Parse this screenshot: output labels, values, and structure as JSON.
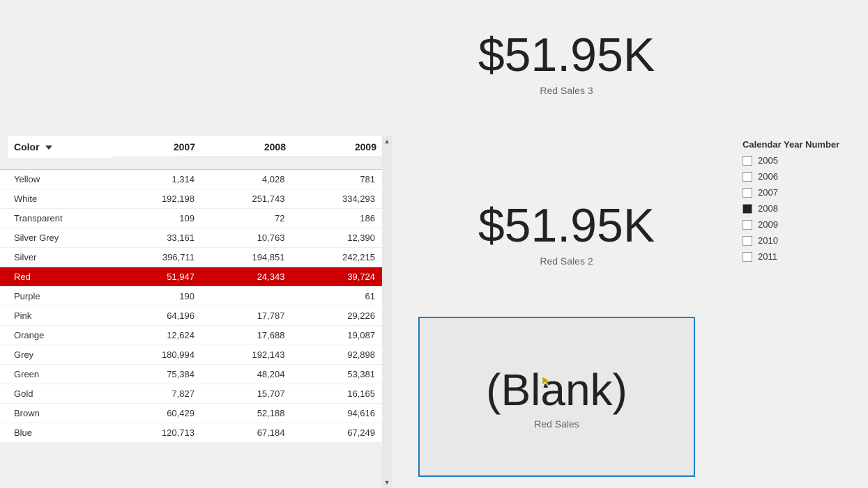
{
  "header": {
    "color_label": "Color  2007"
  },
  "kpi_top": {
    "value": "$51.95K",
    "label": "Red Sales 3"
  },
  "kpi_middle": {
    "value": "$51.95K",
    "label": "Red Sales 2"
  },
  "blank_card": {
    "value": "(Blank)",
    "label": "Red Sales"
  },
  "table": {
    "headers": [
      "Color",
      "2007",
      "2008",
      "2009"
    ],
    "rows": [
      {
        "color": "Yellow",
        "v2007": "1,314",
        "v2008": "4,028",
        "v2009": "781",
        "highlight": false
      },
      {
        "color": "White",
        "v2007": "192,198",
        "v2008": "251,743",
        "v2009": "334,293",
        "highlight": false
      },
      {
        "color": "Transparent",
        "v2007": "109",
        "v2008": "72",
        "v2009": "186",
        "highlight": false
      },
      {
        "color": "Silver Grey",
        "v2007": "33,161",
        "v2008": "10,763",
        "v2009": "12,390",
        "highlight": false
      },
      {
        "color": "Silver",
        "v2007": "396,711",
        "v2008": "194,851",
        "v2009": "242,215",
        "highlight": false
      },
      {
        "color": "Red",
        "v2007": "51,947",
        "v2008": "24,343",
        "v2009": "39,724",
        "highlight": true
      },
      {
        "color": "Purple",
        "v2007": "190",
        "v2008": "",
        "v2009": "61",
        "highlight": false
      },
      {
        "color": "Pink",
        "v2007": "64,196",
        "v2008": "17,787",
        "v2009": "29,226",
        "highlight": false
      },
      {
        "color": "Orange",
        "v2007": "12,624",
        "v2008": "17,688",
        "v2009": "19,087",
        "highlight": false
      },
      {
        "color": "Grey",
        "v2007": "180,994",
        "v2008": "192,143",
        "v2009": "92,898",
        "highlight": false
      },
      {
        "color": "Green",
        "v2007": "75,384",
        "v2008": "48,204",
        "v2009": "53,381",
        "highlight": false
      },
      {
        "color": "Gold",
        "v2007": "7,827",
        "v2008": "15,707",
        "v2009": "16,165",
        "highlight": false
      },
      {
        "color": "Brown",
        "v2007": "60,429",
        "v2008": "52,188",
        "v2009": "94,616",
        "highlight": false
      },
      {
        "color": "Blue",
        "v2007": "120,713",
        "v2008": "67,184",
        "v2009": "67,249",
        "highlight": false
      }
    ]
  },
  "legend": {
    "title": "Calendar Year Number",
    "items": [
      {
        "year": "2005",
        "checked": false
      },
      {
        "year": "2006",
        "checked": false
      },
      {
        "year": "2007",
        "checked": false
      },
      {
        "year": "2008",
        "checked": true
      },
      {
        "year": "2009",
        "checked": false
      },
      {
        "year": "2010",
        "checked": false
      },
      {
        "year": "2011",
        "checked": false
      }
    ]
  }
}
